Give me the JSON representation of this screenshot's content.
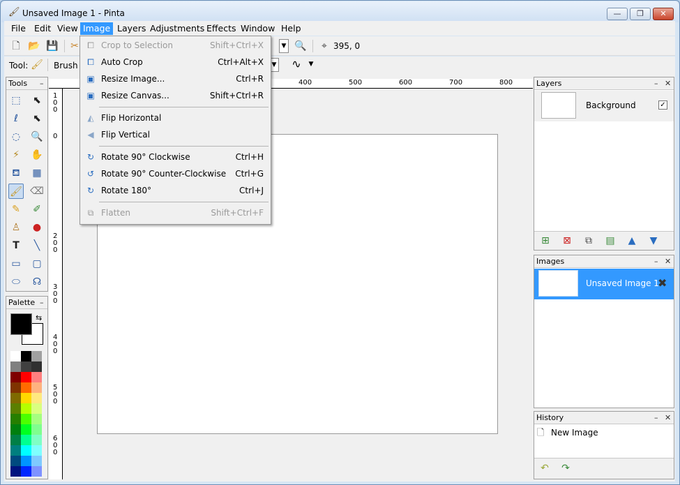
{
  "window": {
    "title": "Unsaved Image 1 - Pinta",
    "controls": {
      "minimize": "—",
      "restore": "❐",
      "close": "✕"
    }
  },
  "menubar": {
    "items": [
      {
        "label": "File"
      },
      {
        "label": "Edit"
      },
      {
        "label": "View"
      },
      {
        "label": "Image"
      },
      {
        "label": "Layers"
      },
      {
        "label": "Adjustments"
      },
      {
        "label": "Effects"
      },
      {
        "label": "Window"
      },
      {
        "label": "Help"
      }
    ],
    "active": "Image"
  },
  "toolbar": {
    "cursor_position": "395, 0",
    "tool_label": "Tool:",
    "brush_width_label": "Brush w"
  },
  "image_menu": {
    "items": [
      {
        "label": "Crop to Selection",
        "shortcut": "Shift+Ctrl+X",
        "enabled": false,
        "icon": "crop-icon"
      },
      {
        "label": "Auto Crop",
        "shortcut": "Ctrl+Alt+X",
        "enabled": true,
        "icon": "auto-crop-icon"
      },
      {
        "label": "Resize Image...",
        "shortcut": "Ctrl+R",
        "enabled": true,
        "icon": "resize-image-icon"
      },
      {
        "label": "Resize Canvas...",
        "shortcut": "Shift+Ctrl+R",
        "enabled": true,
        "icon": "resize-canvas-icon"
      },
      {
        "label": "Flip Horizontal",
        "shortcut": "",
        "enabled": true,
        "icon": "flip-horizontal-icon"
      },
      {
        "label": "Flip Vertical",
        "shortcut": "",
        "enabled": true,
        "icon": "flip-vertical-icon"
      },
      {
        "label": "Rotate 90° Clockwise",
        "shortcut": "Ctrl+H",
        "enabled": true,
        "icon": "rotate-cw-icon"
      },
      {
        "label": "Rotate 90° Counter-Clockwise",
        "shortcut": "Ctrl+G",
        "enabled": true,
        "icon": "rotate-ccw-icon"
      },
      {
        "label": "Rotate 180°",
        "shortcut": "Ctrl+J",
        "enabled": true,
        "icon": "rotate-180-icon"
      },
      {
        "label": "Flatten",
        "shortcut": "Shift+Ctrl+F",
        "enabled": false,
        "icon": "flatten-icon"
      }
    ]
  },
  "tools_panel": {
    "title": "Tools"
  },
  "palette_panel": {
    "title": "Palette",
    "primary_color": "#000000",
    "secondary_color": "#ffffff"
  },
  "rulers": {
    "top_labels": [
      "400",
      "500",
      "600",
      "700",
      "800"
    ],
    "left_labels": [
      "100",
      "0",
      "200",
      "300",
      "400",
      "500",
      "600"
    ]
  },
  "layers_panel": {
    "title": "Layers",
    "layers": [
      {
        "name": "Background",
        "visible": true
      }
    ]
  },
  "images_panel": {
    "title": "Images",
    "images": [
      {
        "name": "Unsaved Image 1",
        "close": "✖"
      }
    ]
  },
  "history_panel": {
    "title": "History",
    "items": [
      {
        "label": "New Image"
      }
    ]
  },
  "panel_controls": {
    "minimize": "–",
    "close": "✕"
  }
}
